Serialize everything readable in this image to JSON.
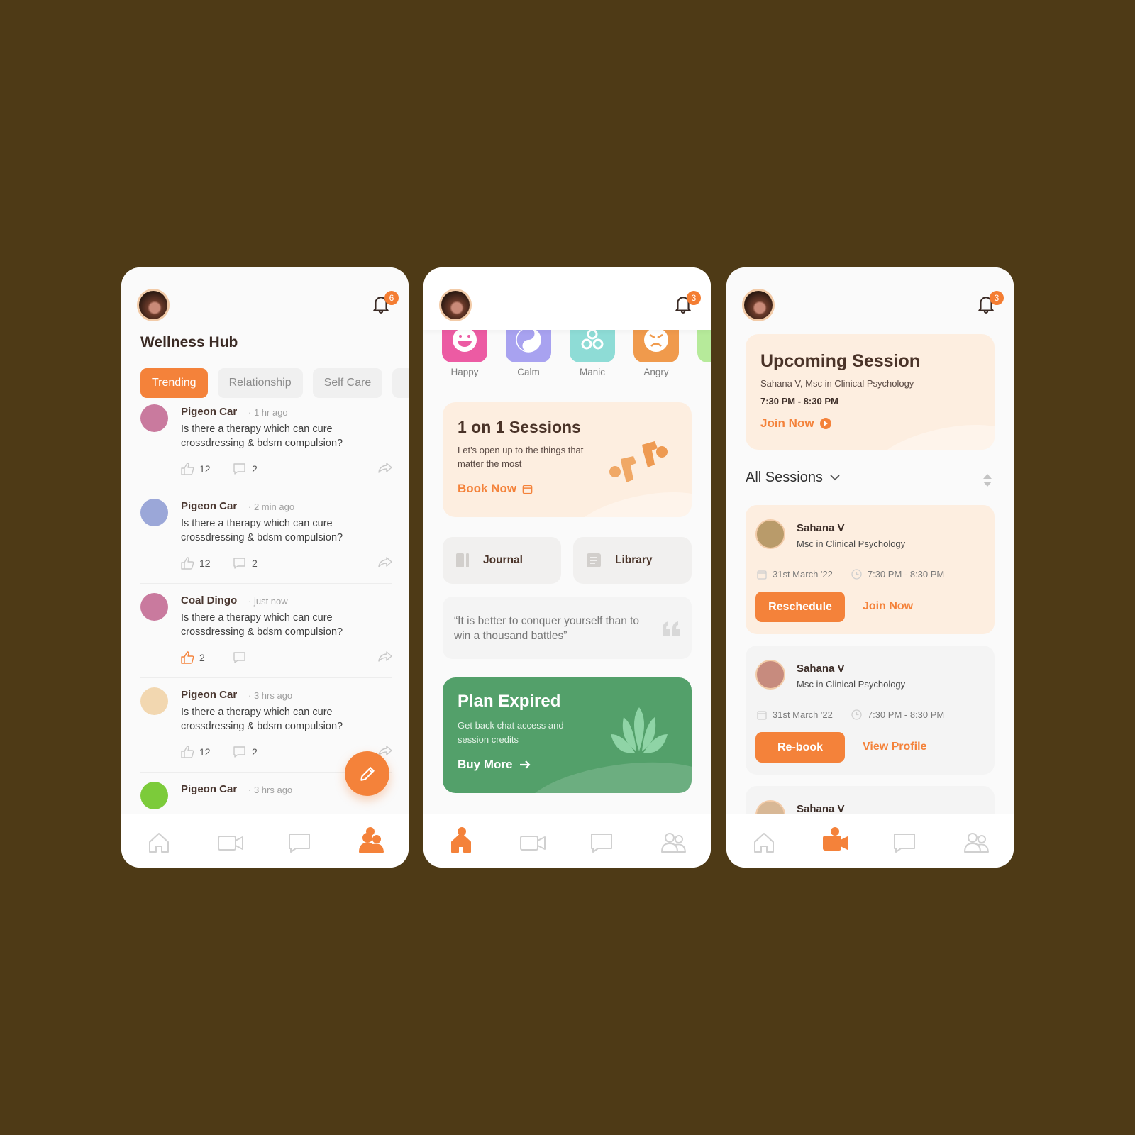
{
  "colors": {
    "accent": "#f4823a",
    "background": "#4e3a16",
    "green": "#53a06a",
    "peach": "#fdeee0"
  },
  "screen1": {
    "notifications": "6",
    "title": "Wellness Hub",
    "chips": [
      "Trending",
      "Relationship",
      "Self Care"
    ],
    "posts": [
      {
        "name": "Pigeon Car",
        "time": "1 hr ago",
        "body": "Is there a therapy which can cure crossdressing & bdsm compulsion?",
        "likes": "12",
        "comments": "2",
        "liked": false
      },
      {
        "name": "Pigeon Car",
        "time": "2 min ago",
        "body": "Is there a therapy which can cure crossdressing & bdsm compulsion?",
        "likes": "12",
        "comments": "2",
        "liked": false
      },
      {
        "name": "Coal Dingo",
        "time": "just now",
        "body": "Is there a therapy which can cure crossdressing & bdsm compulsion?",
        "likes": "2",
        "comments": "",
        "liked": true
      },
      {
        "name": "Pigeon Car",
        "time": "3 hrs ago",
        "body": "Is there a therapy which can cure crossdressing & bdsm compulsion?",
        "likes": "12",
        "comments": "2",
        "liked": false
      },
      {
        "name": "Pigeon Car",
        "time": "3 hrs ago",
        "body": "",
        "likes": "",
        "comments": "",
        "liked": false
      }
    ],
    "fab_icon": "pencil-icon",
    "nav": [
      "home-icon",
      "video-icon",
      "chat-icon",
      "community-icon"
    ],
    "nav_active": "community"
  },
  "screen2": {
    "notifications": "3",
    "moods": [
      {
        "label": "Happy",
        "color": "#ec5ba3",
        "icon": "happy-face-icon"
      },
      {
        "label": "Calm",
        "color": "#a8a2f0",
        "icon": "yin-yang-icon"
      },
      {
        "label": "Manic",
        "color": "#8edcd6",
        "icon": "triskelion-icon"
      },
      {
        "label": "Angry",
        "color": "#f09a4c",
        "icon": "angry-face-icon"
      }
    ],
    "session_card": {
      "title": "1 on 1 Sessions",
      "subtitle": "Let's open up to the things that matter the most",
      "cta": "Book Now"
    },
    "tiles": [
      {
        "label": "Journal",
        "icon": "journal-icon"
      },
      {
        "label": "Library",
        "icon": "library-icon"
      }
    ],
    "quote": "“It is better to conquer yourself than to win a thousand battles”",
    "plan": {
      "title": "Plan Expired",
      "subtitle": "Get back chat access and session credits",
      "cta": "Buy More"
    },
    "nav_active": "home"
  },
  "screen3": {
    "notifications": "3",
    "upcoming": {
      "title": "Upcoming Session",
      "therapist": "Sahana V, Msc in Clinical Psychology",
      "time": "7:30 PM - 8:30 PM",
      "cta": "Join Now"
    },
    "list_title": "All Sessions",
    "sessions": [
      {
        "name": "Sahana V",
        "degree": "Msc in Clinical Psychology",
        "date": "31st March '22",
        "time": "7:30 PM - 8:30 PM",
        "primary": "Reschedule",
        "secondary": "Join Now"
      },
      {
        "name": "Sahana V",
        "degree": "Msc in Clinical Psychology",
        "date": "31st March '22",
        "time": "7:30 PM - 8:30 PM",
        "primary": "Re-book",
        "secondary": "View Profile"
      },
      {
        "name": "Sahana V"
      }
    ],
    "nav_active": "video"
  }
}
